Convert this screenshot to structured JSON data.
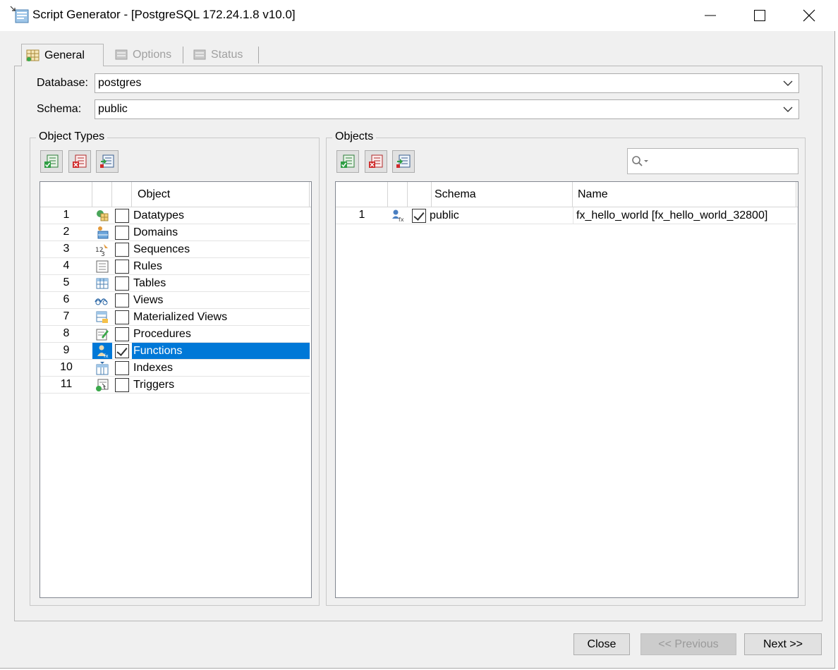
{
  "window": {
    "title": "Script Generator - [PostgreSQL 172.24.1.8 v10.0]",
    "icon": "database-script-icon"
  },
  "tabs": [
    {
      "label": "General",
      "icon": "grid-icon",
      "active": true
    },
    {
      "label": "Options",
      "icon": "options-icon",
      "active": false
    },
    {
      "label": "Status",
      "icon": "status-icon",
      "active": false
    }
  ],
  "form": {
    "database_label": "Database:",
    "database_value": "postgres",
    "schema_label": "Schema:",
    "schema_value": "public"
  },
  "object_types": {
    "title": "Object Types",
    "column_header": "Object",
    "rows": [
      {
        "num": "1",
        "name": "Datatypes",
        "icon": "datatypes-icon",
        "checked": false,
        "selected": false
      },
      {
        "num": "2",
        "name": "Domains",
        "icon": "domains-icon",
        "checked": false,
        "selected": false
      },
      {
        "num": "3",
        "name": "Sequences",
        "icon": "sequences-icon",
        "checked": false,
        "selected": false
      },
      {
        "num": "4",
        "name": "Rules",
        "icon": "rules-icon",
        "checked": false,
        "selected": false
      },
      {
        "num": "5",
        "name": "Tables",
        "icon": "tables-icon",
        "checked": false,
        "selected": false
      },
      {
        "num": "6",
        "name": "Views",
        "icon": "views-icon",
        "checked": false,
        "selected": false
      },
      {
        "num": "7",
        "name": "Materialized Views",
        "icon": "materialized-views-icon",
        "checked": false,
        "selected": false
      },
      {
        "num": "8",
        "name": "Procedures",
        "icon": "procedures-icon",
        "checked": false,
        "selected": false
      },
      {
        "num": "9",
        "name": "Functions",
        "icon": "functions-icon",
        "checked": true,
        "selected": true
      },
      {
        "num": "10",
        "name": "Indexes",
        "icon": "indexes-icon",
        "checked": false,
        "selected": false
      },
      {
        "num": "11",
        "name": "Triggers",
        "icon": "triggers-icon",
        "checked": false,
        "selected": false
      }
    ]
  },
  "objects": {
    "title": "Objects",
    "search_placeholder": "",
    "columns": [
      "Schema",
      "Name"
    ],
    "rows": [
      {
        "num": "1",
        "schema": "public",
        "name": "fx_hello_world [fx_hello_world_32800]",
        "checked": true
      }
    ]
  },
  "buttons": {
    "close": "Close",
    "previous": "<< Previous",
    "next": "Next >>"
  },
  "colors": {
    "selection": "#0078d7",
    "window_bg": "#f0f0f0"
  }
}
